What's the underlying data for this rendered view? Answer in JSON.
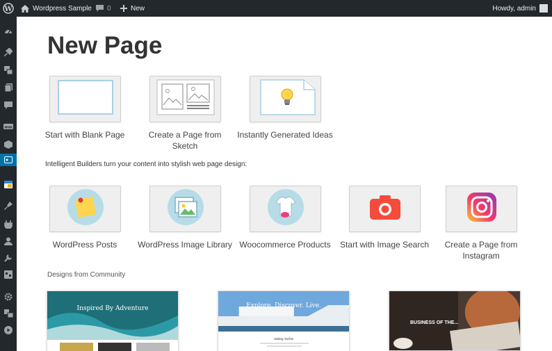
{
  "adminbar": {
    "site_name": "Wordpress Sample",
    "comments_count": "0",
    "new_label": "New",
    "howdy": "Howdy, admin"
  },
  "page": {
    "title": "New Page",
    "intro_text": "Intelligent Builders turn your content into stylish web page design:",
    "community_heading": "Designs from Community"
  },
  "start_options": [
    {
      "label": "Start with Blank Page",
      "icon": "blank-page-icon"
    },
    {
      "label": "Create a Page from Sketch",
      "icon": "sketch-icon"
    },
    {
      "label": "Instantly Generated Ideas",
      "icon": "lightbulb-icon"
    }
  ],
  "builders": [
    {
      "label": "WordPress Posts",
      "icon": "sticky-note-icon"
    },
    {
      "label": "WordPress Image Library",
      "icon": "image-library-icon"
    },
    {
      "label": "Woocommerce Products",
      "icon": "tshirt-icon"
    },
    {
      "label": "Start with Image Search",
      "icon": "camera-icon"
    },
    {
      "label": "Create a Page from Instagram",
      "icon": "instagram-icon"
    }
  ],
  "community_designs": [
    {
      "headline": "Inspired By Adventure"
    },
    {
      "headline": "Explore. Discover. Live.",
      "subtext": "Sailing Yachts"
    },
    {
      "headline": "BUSINESS OF THE..."
    }
  ],
  "colors": {
    "admin_dark": "#23282d",
    "active_blue": "#0073aa",
    "camera_red": "#f44b3c"
  }
}
